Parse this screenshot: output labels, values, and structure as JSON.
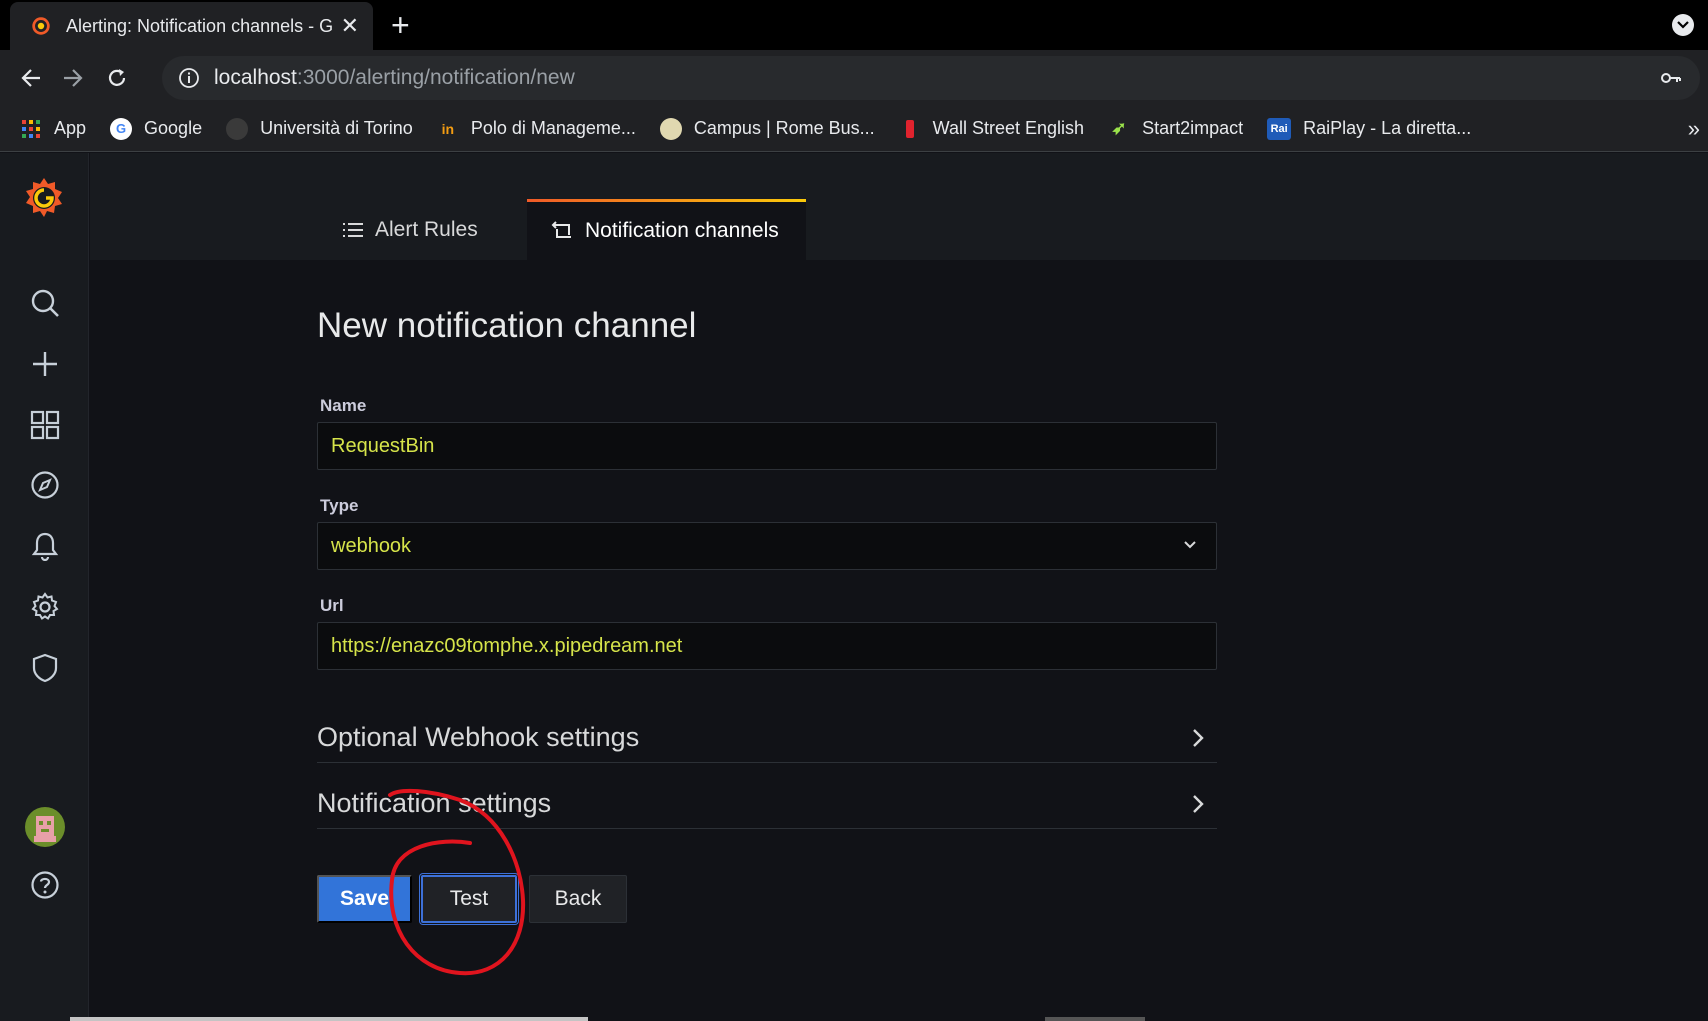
{
  "browser": {
    "tab_title": "Alerting: Notification channels - G",
    "url_host": "localhost",
    "url_path": ":3000/alerting/notification/new",
    "bookmarks": [
      {
        "label": "App",
        "icon": "apps-grid-icon"
      },
      {
        "label": "Google",
        "icon": "google-icon"
      },
      {
        "label": "Università di Torino",
        "icon": "unito-icon"
      },
      {
        "label": "Polo di Manageme...",
        "icon": "polo-icon"
      },
      {
        "label": "Campus | Rome Bus...",
        "icon": "campus-icon"
      },
      {
        "label": "Wall Street English",
        "icon": "wse-icon"
      },
      {
        "label": "Start2impact",
        "icon": "rocket-icon"
      },
      {
        "label": "RaiPlay - La diretta...",
        "icon": "rai-icon"
      }
    ],
    "bookmarks_more": "»"
  },
  "tabs": {
    "alert_rules": "Alert Rules",
    "notification_channels": "Notification channels"
  },
  "page": {
    "title": "New notification channel"
  },
  "form": {
    "name_label": "Name",
    "name_value": "RequestBin",
    "type_label": "Type",
    "type_value": "webhook",
    "url_label": "Url",
    "url_value": "https://enazc09tomphe.x.pipedream.net"
  },
  "sections": {
    "optional_webhook": "Optional Webhook settings",
    "notification_settings": "Notification settings"
  },
  "buttons": {
    "save": "Save",
    "test": "Test",
    "back": "Back"
  },
  "colors": {
    "accent_blue": "#3274d9",
    "field_text": "#d6e44a",
    "annotation_red": "#e0141e",
    "grafana_orange": "#f05a28"
  }
}
